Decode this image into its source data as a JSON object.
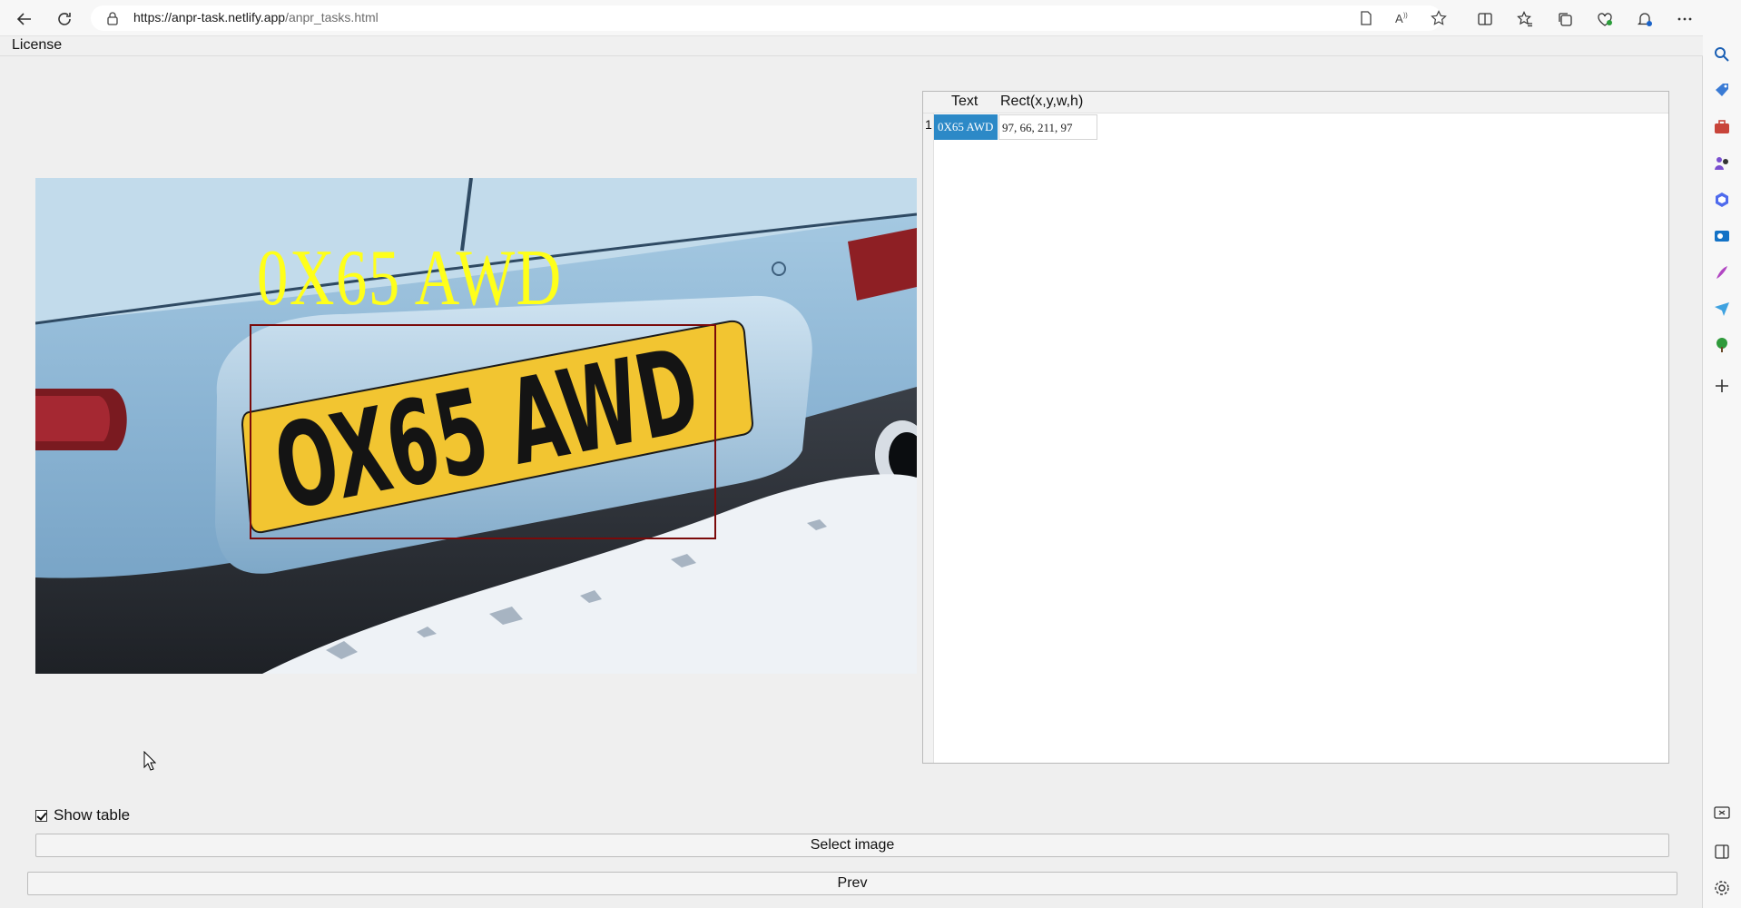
{
  "browser": {
    "url_domain": "https://anpr-task.netlify.app",
    "url_path": "/anpr_tasks.html",
    "nav_icons": [
      "back-icon",
      "refresh-icon"
    ],
    "address_icons": [
      "lock-icon",
      "reader-mode-icon",
      "read-aloud-icon",
      "favorite-star-icon"
    ],
    "toolbar_icons": [
      "split-screen-icon",
      "favorites-icon",
      "collections-icon",
      "browser-essentials-icon",
      "notifications-icon",
      "more-icon",
      "copilot-icon"
    ]
  },
  "sidebar": {
    "icons": [
      "search-icon",
      "shopping-tag-icon",
      "tools-icon",
      "games-icon",
      "microsoft365-icon",
      "outlook-icon",
      "designer-icon",
      "send-icon",
      "tree-icon",
      "add-icon",
      "screenshot-icon",
      "sidebar-toggle-icon",
      "settings-icon"
    ]
  },
  "app": {
    "title": "License"
  },
  "image": {
    "overlay_text": "0X65  AWD",
    "plate_text": "OX65 AWD"
  },
  "table": {
    "headers": [
      "Text",
      "Rect(x,y,w,h)"
    ],
    "rows": [
      {
        "index": "1",
        "text": "0X65  AWD",
        "rect": "97, 66, 211, 97"
      }
    ]
  },
  "controls": {
    "show_table_label": "Show table",
    "show_table_checked": true,
    "select_image_label": "Select image",
    "prev_label": "Prev"
  },
  "colors": {
    "overlay_text": "#ffff1a",
    "detect_box": "#7a0a0a",
    "selected_cell": "#2c89c7",
    "plate_yellow": "#f2c531"
  }
}
